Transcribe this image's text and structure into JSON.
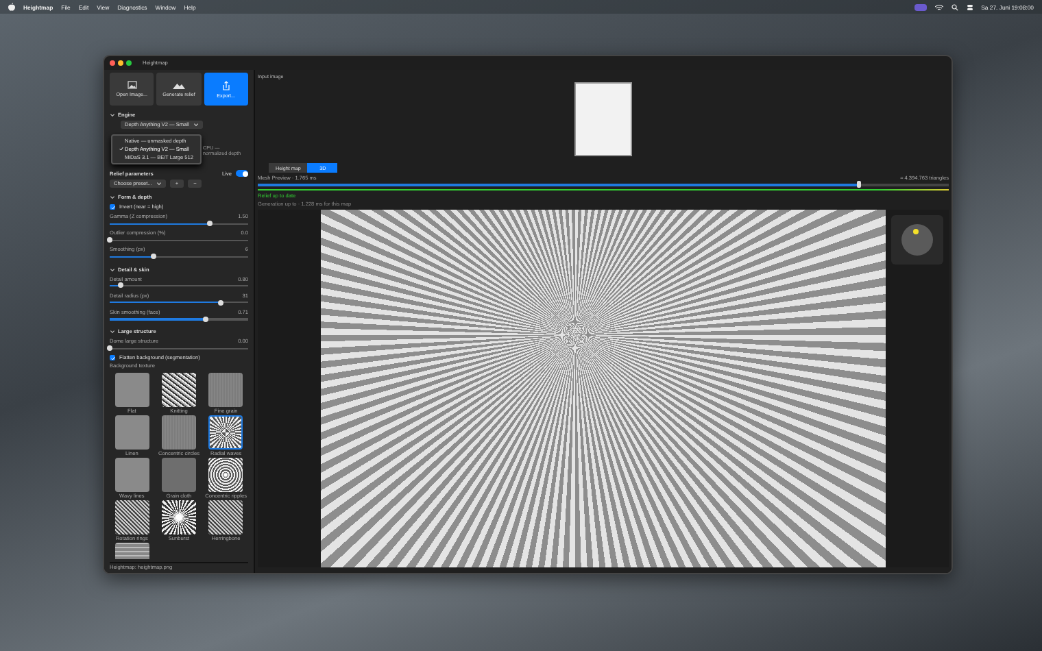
{
  "menu_bar": {
    "app": "Heightmap",
    "items": [
      "File",
      "Edit",
      "View",
      "Diagnostics",
      "Window",
      "Help"
    ],
    "clock": "Sa 27. Juni 19:08:00"
  },
  "window": {
    "title": "Heightmap"
  },
  "sidebar": {
    "actions": [
      {
        "label": "Open Image...",
        "kind": "image",
        "selected": false
      },
      {
        "label": "Generate relief",
        "kind": "mountain",
        "selected": false
      },
      {
        "label": "Export...",
        "kind": "export",
        "selected": true
      }
    ],
    "engine": {
      "title": "Engine",
      "expanded": true,
      "model": "Depth Anything V2 — Small",
      "note": "CPU — normalized depth",
      "options": [
        {
          "label": "Native — unmasked depth",
          "selected": false
        },
        {
          "label": "Depth Anything V2 — Small",
          "selected": true
        },
        {
          "label": "MiDaS 3.1 — BEiT Large 512",
          "selected": false
        }
      ]
    },
    "relief": {
      "title": "Relief parameters",
      "live_label": "Live",
      "live": true,
      "preset": "Choose preset...",
      "buttons": [
        "+",
        "−"
      ]
    },
    "sections": [
      {
        "title": "Form & depth",
        "expanded": true,
        "controls": [
          {
            "kind": "checkbox",
            "label": "Invert (near = high)",
            "checked": true
          },
          {
            "kind": "slider",
            "label": "Gamma (Z compression)",
            "value": "1.50",
            "level": 0.72
          },
          {
            "kind": "slider",
            "label": "Outlier compression (%)",
            "value": "0.0",
            "level": 0.0
          },
          {
            "kind": "slider",
            "label": "Smoothing (px)",
            "value": "6",
            "level": 0.32
          }
        ]
      },
      {
        "title": "Detail & skin",
        "expanded": true,
        "controls": [
          {
            "kind": "slider",
            "label": "Detail amount",
            "value": "0.80",
            "level": 0.08
          },
          {
            "kind": "slider",
            "label": "Detail radius (px)",
            "value": "31",
            "level": 0.8
          },
          {
            "kind": "slider",
            "label": "Skin smoothing (face)",
            "value": "0.71",
            "level": 0.69
          }
        ]
      },
      {
        "title": "Large structure",
        "expanded": true,
        "controls": [
          {
            "kind": "slider",
            "label": "Dome large structure",
            "value": "0.00",
            "level": 0.0
          },
          {
            "kind": "checkbox",
            "label": "Flatten background (segmentation)",
            "checked": true
          },
          {
            "kind": "caption",
            "label": "Background texture"
          }
        ]
      }
    ],
    "textures": [
      {
        "label": "Flat",
        "kind": "flat",
        "selected": false
      },
      {
        "label": "Knitting",
        "kind": "noise",
        "selected": false
      },
      {
        "label": "Fine grain",
        "kind": "grain",
        "selected": false
      },
      {
        "label": "Linen",
        "kind": "flat",
        "selected": false
      },
      {
        "label": "Concentric circles",
        "kind": "grain",
        "selected": false
      },
      {
        "label": "Radial waves",
        "kind": "radial",
        "selected": true
      },
      {
        "label": "Wavy lines",
        "kind": "flat",
        "selected": false
      },
      {
        "label": "Grain cloth",
        "kind": "dark",
        "selected": false
      },
      {
        "label": "Concentric ripples",
        "kind": "rings",
        "selected": false
      },
      {
        "label": "Rotation rings",
        "kind": "weave",
        "selected": false
      },
      {
        "label": "Sunburst",
        "kind": "sunburst",
        "selected": false
      },
      {
        "label": "Herringbone",
        "kind": "weave",
        "selected": false
      },
      {
        "kind": "grid",
        "selected": false
      }
    ],
    "footer": "Heightmap: heightmap.png"
  },
  "main": {
    "header": "Input image",
    "view_tabs": [
      {
        "label": "Height map",
        "selected": false
      },
      {
        "label": "3D",
        "selected": true
      }
    ],
    "mesh_label": "Mesh Preview · 1.765 ms",
    "mesh": {
      "level": 0.87
    },
    "triangles": "≈ 4.394.763 triangles",
    "progress": {
      "level": 1
    },
    "status": "Relief up to date",
    "substatus": "Generation up to · 1.228 ms for this map"
  }
}
